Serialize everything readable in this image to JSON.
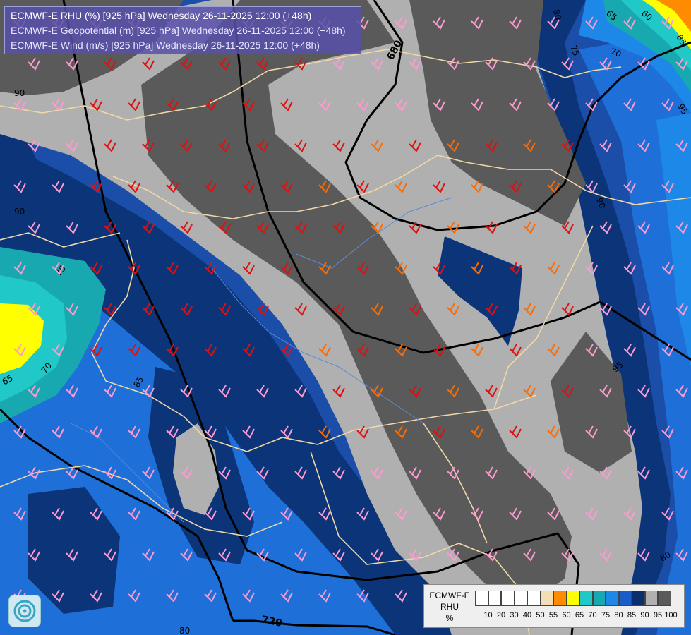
{
  "header": {
    "line1": "ECMWF-E RHU (%) [925 hPa] Wednesday 26-11-2025 12:00 (+48h)",
    "line2": "ECMWF-E Geopotential (m) [925 hPa] Wednesday 26-11-2025 12:00 (+48h)",
    "line3": "ECMWF-E Wind (m/s) [925 hPa] Wednesday 26-11-2025 12:00 (+48h)"
  },
  "contour_labels": {
    "geo_680": "680",
    "geo_720": "720",
    "rhu_95_right": "95",
    "rhu_90_left": "90",
    "rhu_90_top": "90",
    "rhu_75": "75",
    "rhu_70_left": "70",
    "rhu_65_left": "65",
    "rhu_80_bottom": "80",
    "rhu_80_right": "80",
    "rhu_85": "85",
    "rhu_65_top": "65",
    "rhu_60_top": "60",
    "rhu_70_top": "70",
    "rhu_75_top": "75",
    "rhu_80_top": "80",
    "rhu_85_top": "85",
    "rhu_95_top": "95",
    "rhu_90_mid": "90"
  },
  "legend": {
    "title_line1": "ECMWF-E",
    "title_line2": "RHU",
    "title_line3": "%",
    "ticks": [
      "10",
      "20",
      "30",
      "40",
      "50",
      "55",
      "60",
      "65",
      "70",
      "75",
      "80",
      "85",
      "90",
      "95",
      "100"
    ],
    "colors": [
      "#ffffff",
      "#ffffff",
      "#ffffff",
      "#ffffff",
      "#ffffff",
      "#f5deb3",
      "#ff8c00",
      "#ffff00",
      "#20c8c8",
      "#18a8b0",
      "#1e88e8",
      "#1a5cc8",
      "#0a2e6e",
      "#b0b0b0",
      "#5a5a5a"
    ]
  },
  "palette": {
    "rhu_100": "#5a5a5a",
    "rhu_95": "#b0b0b0",
    "rhu_90": "#0a2e6e",
    "rhu_85": "#1a4ea8",
    "rhu_80": "#1a64c8",
    "rhu_75": "#1e88e8",
    "rhu_70": "#18a8b0",
    "rhu_65": "#20c8c8",
    "rhu_60": "#ffff00",
    "rhu_55": "#ff8c00",
    "border": "#f0d8a8"
  }
}
